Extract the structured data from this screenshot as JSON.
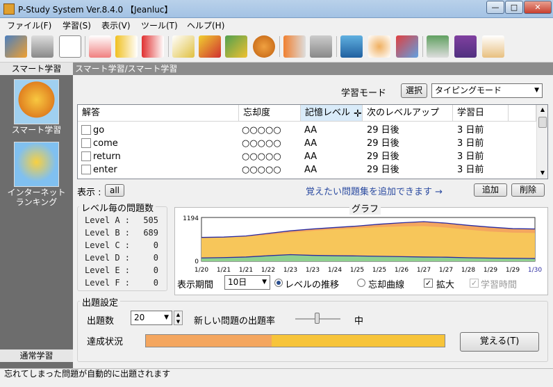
{
  "window": {
    "title": "P-Study System Ver.8.4.0 【Jeanluc】"
  },
  "menu": {
    "items": [
      "ファイル(F)",
      "学習(S)",
      "表示(V)",
      "ツール(T)",
      "ヘルプ(H)"
    ]
  },
  "sidebar": {
    "top_label": "スマート学習",
    "items": [
      {
        "label": "スマート学習"
      },
      {
        "label": "インターネット\nランキング"
      }
    ],
    "bottom_label": "通常学習"
  },
  "breadcrumb": "スマート学習/スマート学習",
  "mode": {
    "label": "学習モード",
    "select_button": "選択",
    "value": "タイピングモード"
  },
  "list": {
    "columns": [
      "解答",
      "忘却度",
      "記憶レベル",
      "次のレベルアップ",
      "学習日"
    ],
    "rows": [
      {
        "answer": "go",
        "forget": "○○○○○",
        "level": "AA",
        "next": "29 日後",
        "date": "3 日前"
      },
      {
        "answer": "come",
        "forget": "○○○○○",
        "level": "AA",
        "next": "29 日後",
        "date": "3 日前"
      },
      {
        "answer": "return",
        "forget": "○○○○○",
        "level": "AA",
        "next": "29 日後",
        "date": "3 日前"
      },
      {
        "answer": "enter",
        "forget": "○○○○○",
        "level": "AA",
        "next": "29 日後",
        "date": "3 日前"
      }
    ]
  },
  "display": {
    "label": "表示 :",
    "value": "all"
  },
  "add_hint": "覚えたい問題集を追加できます →",
  "add_button": "追加",
  "delete_button": "削除",
  "levels": {
    "title": "レベル毎の問題数",
    "items": [
      {
        "name": "Level A :",
        "count": "505"
      },
      {
        "name": "Level B :",
        "count": "689"
      },
      {
        "name": "Level C :",
        "count": "0"
      },
      {
        "name": "Level D :",
        "count": "0"
      },
      {
        "name": "Level E :",
        "count": "0"
      },
      {
        "name": "Level F :",
        "count": "0"
      }
    ]
  },
  "graph": {
    "title": "グラフ"
  },
  "chart_data": {
    "type": "area",
    "y_tick_max": "1194",
    "y_tick_min": "0",
    "x": [
      "1/20",
      "1/21",
      "1/21",
      "1/22",
      "1/23",
      "1/23",
      "1/24",
      "1/25",
      "1/25",
      "1/26",
      "1/27",
      "1/27",
      "1/28",
      "1/29",
      "1/29",
      "1/30"
    ],
    "ylim": [
      0,
      1194
    ],
    "series": [
      {
        "color": "#8fd08f",
        "values": [
          90,
          100,
          115,
          150,
          180,
          160,
          150,
          145,
          135,
          125,
          115,
          110,
          95,
          85,
          80,
          75
        ]
      },
      {
        "color": "#f7c65a",
        "values": [
          640,
          650,
          670,
          720,
          780,
          830,
          870,
          900,
          930,
          950,
          960,
          920,
          860,
          810,
          780,
          770
        ]
      },
      {
        "color": "#f4a65f",
        "values": [
          650,
          660,
          690,
          760,
          830,
          880,
          920,
          960,
          1010,
          1050,
          1080,
          1040,
          980,
          930,
          890,
          880
        ]
      }
    ],
    "colors": {
      "level_a": "#8fd08f",
      "level_b": "#f7c65a",
      "top": "#f4a65f",
      "line": "#2a2aa0"
    }
  },
  "period": {
    "label": "表示期間",
    "value": "10日"
  },
  "options": {
    "level_trend": "レベルの推移",
    "forget_curve": "忘却曲線",
    "zoom": "拡大",
    "study_time": "学習時間"
  },
  "settings": {
    "title": "出題設定",
    "count_label": "出題数",
    "count_value": "20",
    "rate_label": "新しい問題の出題率",
    "rate_value": "中",
    "progress_label": "達成状況",
    "progress_fraction": 0.42,
    "progress_colors": {
      "done": "#f4a65f",
      "remaining": "#f7c43a"
    },
    "memorize_button": "覚える(T)"
  },
  "status": "忘れてしまった問題が自動的に出題されます"
}
